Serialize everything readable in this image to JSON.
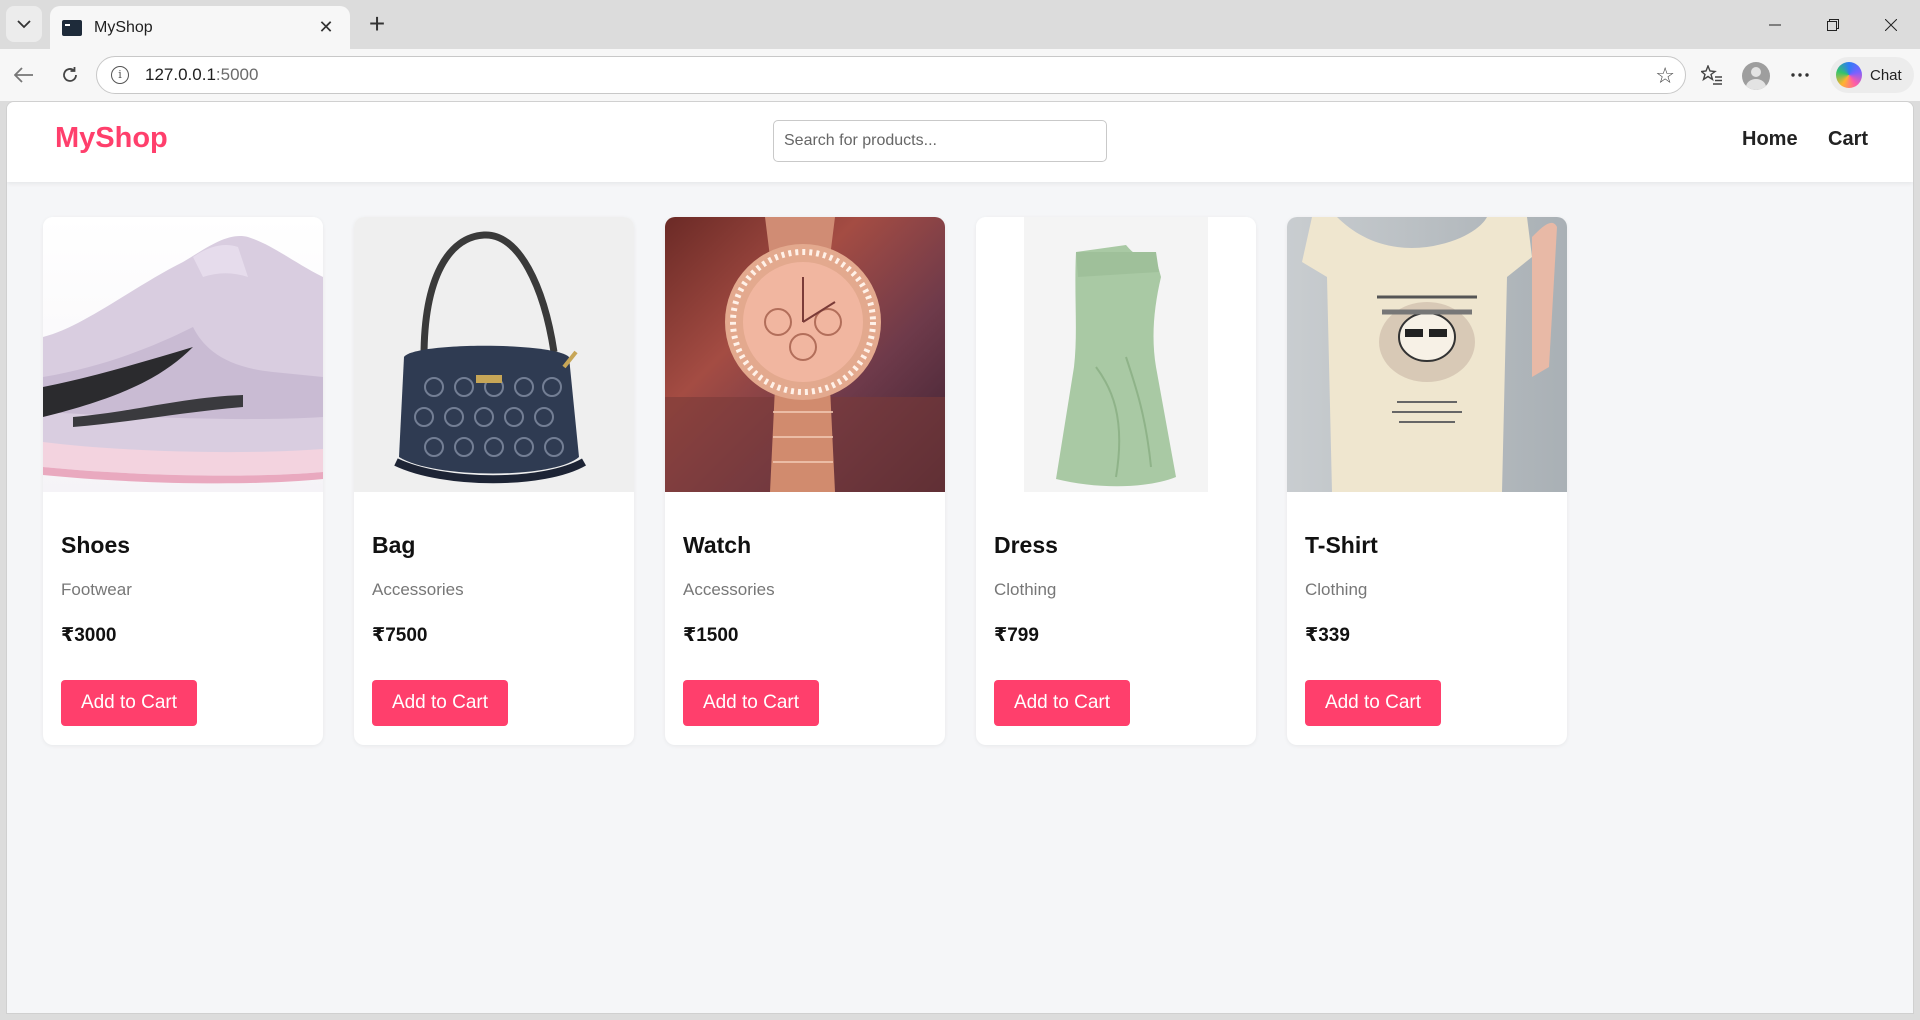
{
  "browser": {
    "tab_title": "MyShop",
    "url_host": "127.0.0.1",
    "url_port": ":5000",
    "chat_label": "Chat"
  },
  "site": {
    "brand": "MyShop",
    "search_placeholder": "Search for products...",
    "nav": [
      "Home",
      "Cart"
    ]
  },
  "products": [
    {
      "name": "Shoes",
      "category": "Footwear",
      "price": "₹3000",
      "button": "Add to Cart"
    },
    {
      "name": "Bag",
      "category": "Accessories",
      "price": "₹7500",
      "button": "Add to Cart"
    },
    {
      "name": "Watch",
      "category": "Accessories",
      "price": "₹1500",
      "button": "Add to Cart"
    },
    {
      "name": "Dress",
      "category": "Clothing",
      "price": "₹799",
      "button": "Add to Cart"
    },
    {
      "name": "T-Shirt",
      "category": "Clothing",
      "price": "₹339",
      "button": "Add to Cart"
    }
  ],
  "colors": {
    "accent": "#ff3f6c",
    "page_bg": "#f5f6f8"
  }
}
